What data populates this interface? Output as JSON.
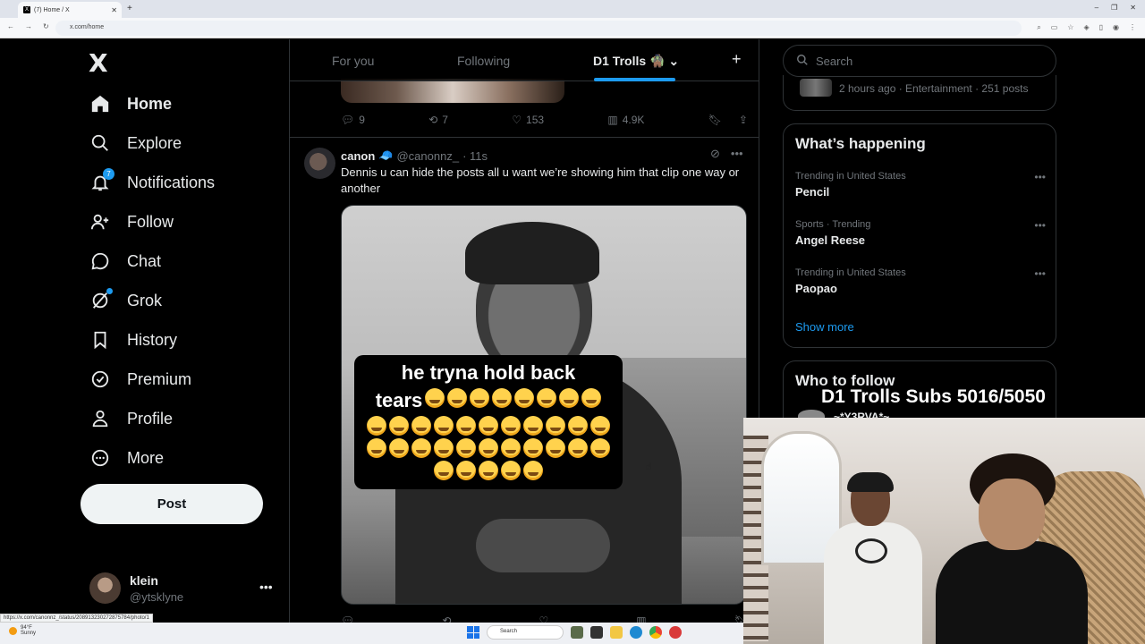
{
  "browser": {
    "tab_title": "(7) Home / X",
    "url": "x.com/home",
    "status_url": "https://x.com/canonnz_/status/208913230272875784/photo/1"
  },
  "nav": {
    "logo": "X",
    "items": [
      {
        "label": "Home",
        "icon": "home-icon",
        "active": true
      },
      {
        "label": "Explore",
        "icon": "search-icon"
      },
      {
        "label": "Notifications",
        "icon": "bell-icon",
        "badge": "7"
      },
      {
        "label": "Follow",
        "icon": "person-plus-icon"
      },
      {
        "label": "Chat",
        "icon": "chat-bubble-icon"
      },
      {
        "label": "Grok",
        "icon": "grok-icon",
        "dot": true
      },
      {
        "label": "History",
        "icon": "bookmark-icon"
      },
      {
        "label": "Premium",
        "icon": "verified-icon"
      },
      {
        "label": "Profile",
        "icon": "person-icon"
      },
      {
        "label": "More",
        "icon": "more-circle-icon"
      }
    ],
    "post_label": "Post",
    "account": {
      "name": "klein",
      "handle": "@ytsklyne"
    }
  },
  "timeline": {
    "tabs": [
      {
        "label": "For you"
      },
      {
        "label": "Following"
      },
      {
        "label": "D1 Trolls 🧌",
        "active": true
      }
    ],
    "prev_actions": {
      "replies": "9",
      "reposts": "7",
      "likes": "153",
      "views": "4.9K"
    },
    "tweet": {
      "name": "canon",
      "handle": "@canonnz_",
      "time": "· 11s",
      "text": "Dennis u can hide the posts all u want we’re showing him that clip one way or another",
      "caption_line1": "he tryna hold back",
      "caption_line2": "tears"
    }
  },
  "right": {
    "search_placeholder": "Search",
    "prev_card_meta": "2 hours ago · Entertainment · 251 posts",
    "happening_title": "What’s happening",
    "trends": [
      {
        "context": "Trending in United States",
        "name": "Pencil"
      },
      {
        "context": "Sports · Trending",
        "name": "Angel Reese"
      },
      {
        "context": "Trending in United States",
        "name": "Paopao"
      }
    ],
    "show_more": "Show more",
    "who_to_follow_title": "Who to follow",
    "who_to_follow_name": "~*Y3RVA*~"
  },
  "overlay": {
    "subs_text": "D1 Trolls Subs 5016/5050"
  },
  "taskbar": {
    "weather_temp": "94°F",
    "weather_desc": "Sunny",
    "search_placeholder": "Search"
  }
}
